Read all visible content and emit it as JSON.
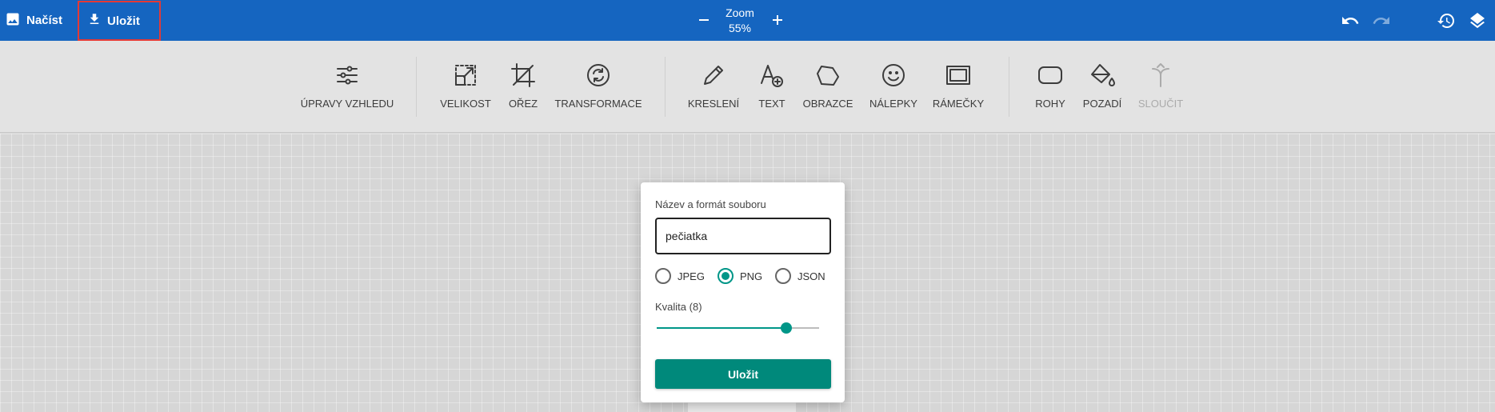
{
  "topbar": {
    "load_label": "Načíst",
    "load_icon": "image-icon",
    "save_label": "Uložit",
    "save_icon": "download-icon",
    "zoom_title": "Zoom",
    "zoom_value": "55%",
    "undo_icon": "undo-icon",
    "redo_icon": "redo-icon",
    "history_icon": "history-icon",
    "layers_icon": "layers-icon"
  },
  "toolbar": {
    "tools": [
      {
        "label": "ÚPRAVY VZHLEDU",
        "icon": "sliders-icon"
      },
      {
        "label": "VELIKOST",
        "icon": "resize-icon"
      },
      {
        "label": "OŘEZ",
        "icon": "crop-icon"
      },
      {
        "label": "TRANSFORMACE",
        "icon": "rotate-icon"
      },
      {
        "label": "KRESLENÍ",
        "icon": "pencil-icon"
      },
      {
        "label": "TEXT",
        "icon": "text-add-icon"
      },
      {
        "label": "OBRAZCE",
        "icon": "polygon-icon"
      },
      {
        "label": "NÁLEPKY",
        "icon": "smiley-icon"
      },
      {
        "label": "RÁMEČKY",
        "icon": "frame-icon"
      },
      {
        "label": "ROHY",
        "icon": "rounded-corners-icon"
      },
      {
        "label": "POZADÍ",
        "icon": "paint-bucket-icon"
      },
      {
        "label": "SLOUČIT",
        "icon": "merge-icon",
        "disabled": true
      }
    ]
  },
  "dialog": {
    "filename_label": "Název a formát souboru",
    "filename_value": "pečiatka",
    "formats": [
      {
        "label": "JPEG",
        "checked": false
      },
      {
        "label": "PNG",
        "checked": true
      },
      {
        "label": "JSON",
        "checked": false
      }
    ],
    "quality_label": "Kvalita (8)",
    "quality_value": 8,
    "quality_max": 10,
    "save_button": "Uložit",
    "accent_color": "#009688"
  },
  "colors": {
    "topbar": "#1565c0",
    "highlight_border": "#e53935",
    "toolbar_bg": "#e3e3e3"
  }
}
